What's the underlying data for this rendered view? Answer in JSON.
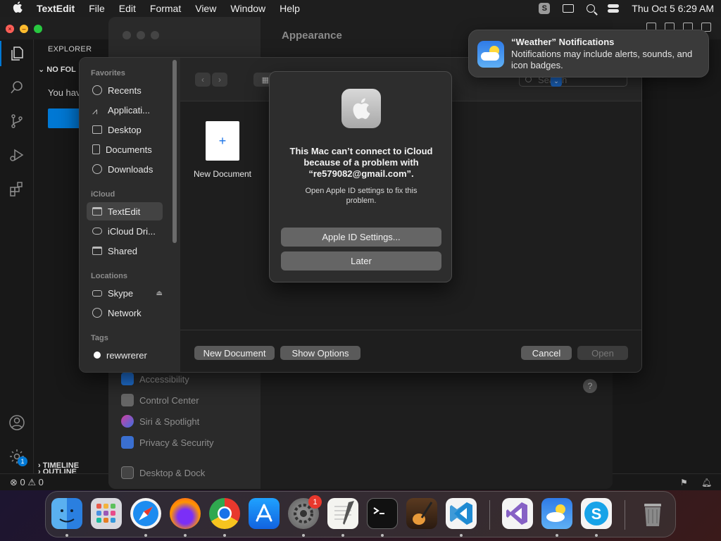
{
  "menubar": {
    "app": "TextEdit",
    "items": [
      "File",
      "Edit",
      "Format",
      "View",
      "Window",
      "Help"
    ],
    "clock": "Thu Oct 5  6:29 AM",
    "skype_glyph": "S"
  },
  "vscode": {
    "explorer_title": "EXPLORER",
    "no_folder": "NO FOL",
    "you_have": "You hav",
    "outline": "OUTLINE",
    "timeline": "TIMELINE",
    "status_errors": "⊗ 0 ⚠ 0",
    "settings_badge": "1"
  },
  "settings": {
    "title": "Appearance",
    "items": [
      "Accessibility",
      "Control Center",
      "Siri & Spotlight",
      "Privacy & Security",
      "Desktop & Dock"
    ],
    "help": "?"
  },
  "open_panel": {
    "favorites_header": "Favorites",
    "favorites": [
      "Recents",
      "Applicati...",
      "Desktop",
      "Documents",
      "Downloads"
    ],
    "icloud_header": "iCloud",
    "icloud": [
      "TextEdit",
      "iCloud Dri...",
      "Shared"
    ],
    "locations_header": "Locations",
    "locations": [
      "Skype",
      "Network"
    ],
    "tags_header": "Tags",
    "tags": [
      "rewwrerer"
    ],
    "search_placeholder": "Search",
    "file_icon_glyph": "+",
    "file_name": "New Document",
    "btn_new_document": "New Document",
    "btn_show_options": "Show Options",
    "btn_cancel": "Cancel",
    "btn_open": "Open"
  },
  "alert": {
    "title": "This Mac can’t connect to iCloud because of a problem with “re579082@gmail.com”.",
    "message": "Open Apple ID settings to fix this problem.",
    "btn_primary": "Apple ID Settings...",
    "btn_later": "Later"
  },
  "notification": {
    "title": "“Weather” Notifications",
    "body": "Notifications may include alerts, sounds, and icon badges."
  },
  "dock": {
    "apps": [
      "Finder",
      "Launchpad",
      "Safari",
      "Firefox",
      "Chrome",
      "App Store",
      "System Settings",
      "TextEdit",
      "Terminal",
      "GarageBand",
      "VS Code",
      "Visual Studio",
      "Weather",
      "Skype",
      "Trash"
    ],
    "settings_badge": "1"
  }
}
